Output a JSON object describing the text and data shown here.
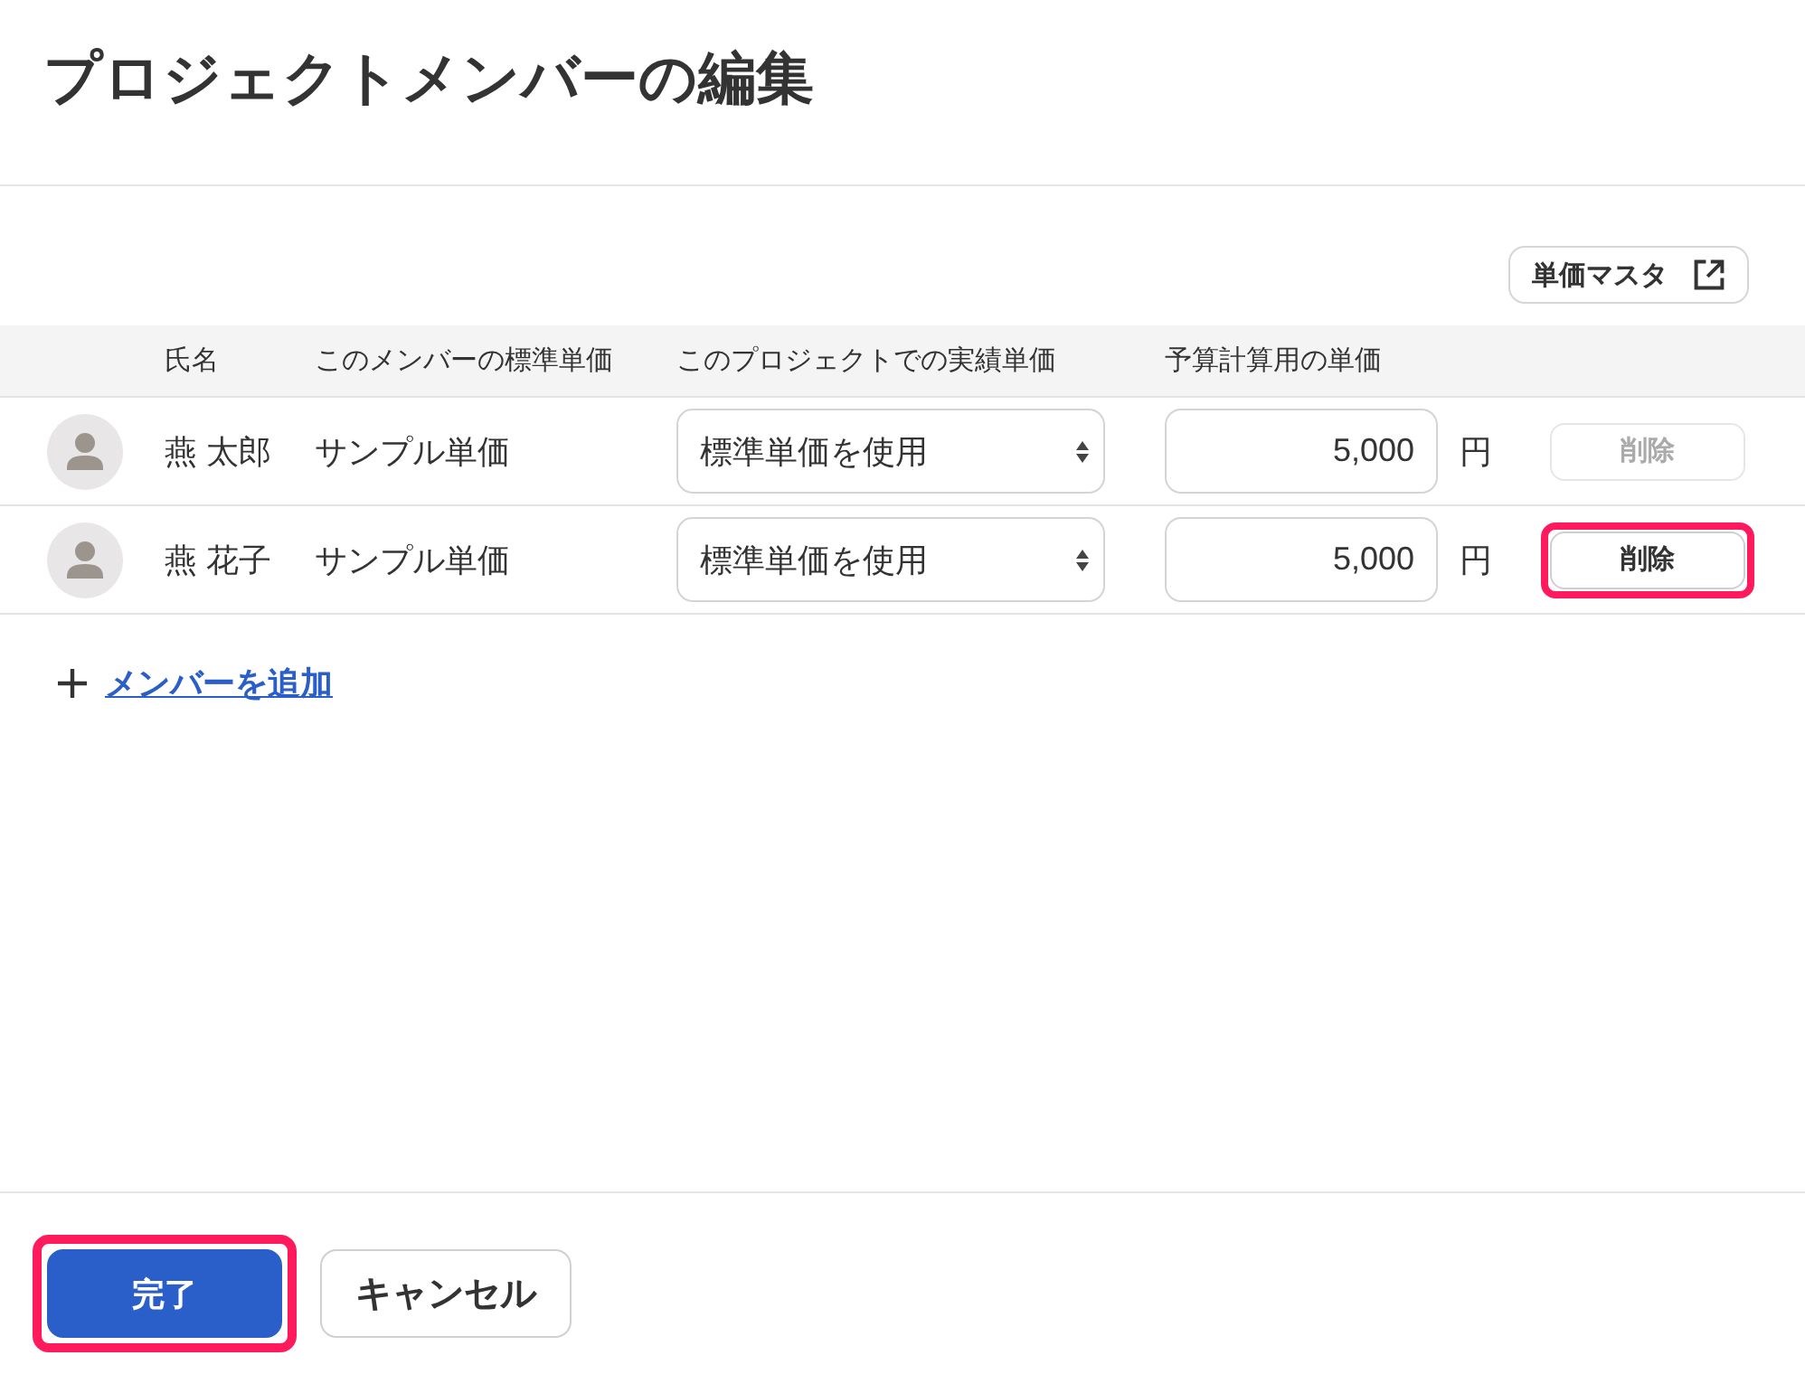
{
  "title": "プロジェクトメンバーの編集",
  "toolbar": {
    "unit_master_button": "単価マスタ"
  },
  "table": {
    "columns": [
      "氏名",
      "このメンバーの標準単価",
      "このプロジェクトでの実績単価",
      "予算計算用の単価"
    ],
    "rows": [
      {
        "name": "燕 太郎",
        "standard_price": "サンプル単価",
        "actual_price": "標準単価を使用",
        "budget_price": "5,000",
        "unit": "円",
        "delete_button": {
          "label": "削除",
          "disabled": true,
          "highlighted": false
        }
      },
      {
        "name": "燕 花子",
        "standard_price": "サンプル単価",
        "actual_price": "標準単価を使用",
        "budget_price": "5,000",
        "unit": "円",
        "delete_button": {
          "label": "削除",
          "disabled": false,
          "highlighted": true
        }
      }
    ]
  },
  "add_member_link": "メンバーを追加",
  "footer": {
    "buttons": [
      {
        "label": "完了",
        "kind": "primary",
        "highlighted": true
      },
      {
        "label": "キャンセル",
        "kind": "secondary",
        "highlighted": false
      }
    ]
  }
}
